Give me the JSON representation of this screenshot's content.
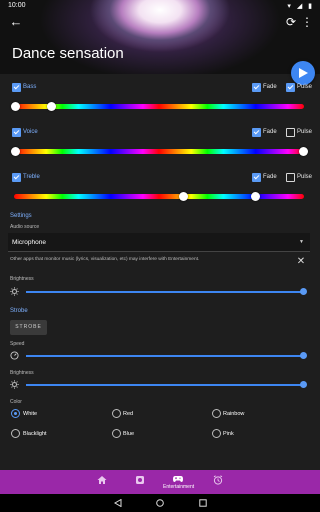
{
  "status_bar": {
    "time": "10:00",
    "icons": "▾ ◢ ▮"
  },
  "header": {
    "title": "Dance sensation"
  },
  "bands": [
    {
      "label": "Bass",
      "fade_label": "Fade",
      "pulse_label": "Pulse"
    },
    {
      "label": "Voice",
      "fade_label": "Fade",
      "pulse_label": "Pulse"
    },
    {
      "label": "Treble",
      "fade_label": "Fade",
      "pulse_label": "Pulse"
    }
  ],
  "settings": {
    "title": "Settings",
    "audio_source_label": "Audio source",
    "audio_source_value": "Microphone",
    "note": "Other apps that monitor music (lyrics, visualization, etc) may interfere with Entertainment.",
    "brightness_label": "Brightness"
  },
  "strobe": {
    "title": "Strobe",
    "button_label": "STROBE",
    "speed_label": "Speed",
    "brightness_label": "Brightness",
    "color_label": "Color",
    "colors": [
      "White",
      "Red",
      "Rainbow",
      "Blacklight",
      "Blue",
      "Pink"
    ],
    "selected_color": "White"
  },
  "bottom_nav": {
    "active_label": "Entertainment"
  },
  "accent_color": "#3d86f2",
  "nav_color": "#9a28a8"
}
